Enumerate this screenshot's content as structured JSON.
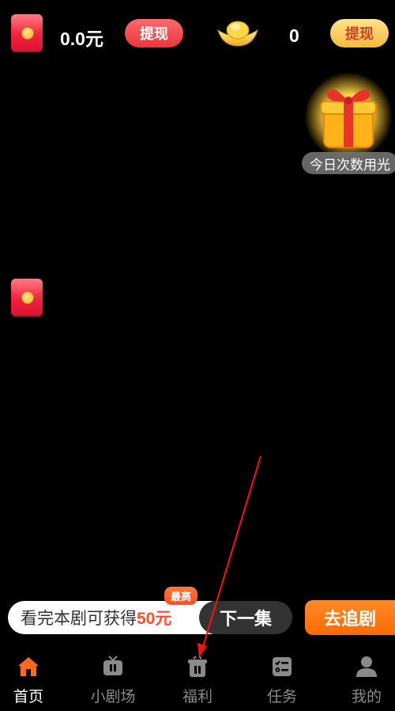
{
  "header": {
    "cash_amount": "0.0元",
    "cash_withdraw_label": "提现",
    "gold_count": "0",
    "gold_withdraw_label": "提现"
  },
  "gift": {
    "tag_text": "今日次数用光"
  },
  "action_row": {
    "badge": "最高",
    "promo_prefix": "看完本剧可获得",
    "promo_amount": "50元",
    "next_label": "下一集",
    "follow_label": "去追剧"
  },
  "tabs": [
    {
      "label": "首页",
      "icon": "home-icon",
      "active": true
    },
    {
      "label": "小剧场",
      "icon": "tv-icon",
      "active": false
    },
    {
      "label": "福利",
      "icon": "gift-box-icon",
      "active": false
    },
    {
      "label": "任务",
      "icon": "checklist-icon",
      "active": false
    },
    {
      "label": "我的",
      "icon": "person-icon",
      "active": false
    }
  ],
  "colors": {
    "accent_orange": "#ff6a00",
    "active_tab": "#ff6a1a",
    "red_button": "#e8363d",
    "gold_button": "#f7b93c",
    "annotation_arrow": "#ff0000"
  }
}
